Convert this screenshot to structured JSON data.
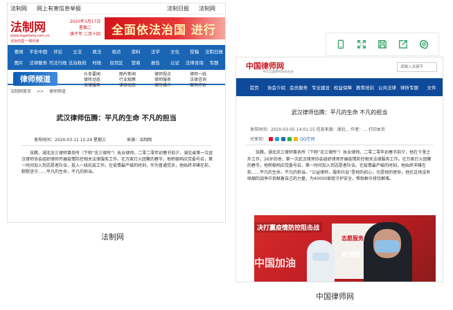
{
  "left": {
    "topbar": [
      "法制网",
      "网上有害信息举报",
      "法制日报",
      "法制网"
    ],
    "logo": "法制网",
    "logo_url": "www.legaldaily.com.cn",
    "logo_tag": "法治中国 一网尽收",
    "date_line1": "2020年3月17日",
    "date_line2": "星期二",
    "date_line3": "庚子年 二月十四",
    "banner": "全面依法治国 进行",
    "nav": [
      "要闻",
      "平安中国",
      "评论",
      "立法",
      "政法",
      "视点",
      "资料",
      "法学",
      "文化",
      "投稿",
      "法制日报",
      "图片",
      "法律服务",
      "司法行政",
      "法治政府",
      "时政",
      "自贸区",
      "营商",
      "报告",
      "公证",
      "法律咨询",
      "专题"
    ],
    "channel": "律师频道",
    "subnav": [
      "头条要闻",
      "图片新闻",
      "律师视点",
      "律师一线",
      "律所动态",
      "行业观察",
      "律师服务",
      "法律咨询",
      "法律服务",
      "律协动态",
      "律所推介",
      "案例评析"
    ],
    "crumb": [
      "法制网首页",
      ">>",
      "律师频道"
    ],
    "title": "武汉律师伍腾：平凡的生命 不凡的担当",
    "meta_time": "发布时间：2020-03-11 15:24 星期三",
    "meta_source": "来源：法制网",
    "body": "伍腾，湖北忠三律师事务所（下称“忠三律所”）执业律师。二零二零年初春节前夕，湖北省第一次武汉律师协会组织律师开展疫情防控相关法律服务工作。在万家灯火团聚的春节，他积极响应党委号召，第一时间加入到志愿者队伍，投入一线抗疫工作。在疫情最严峻的时刻，作为普通党员，他始终冲锋在前，默默坚守……平凡的生命，不凡的担当。",
    "caption": "法制网"
  },
  "toolbar": {
    "icons": [
      "phone-icon",
      "expand-icon",
      "save-icon",
      "share-icon",
      "settings-icon"
    ]
  },
  "right": {
    "logo": "中国律师网",
    "logo_sub": "中华全国律师协会主办",
    "search_placeholder": "请输入关键字",
    "nav": [
      "首页",
      "协会介绍",
      "会员服务",
      "专业建设",
      "权益保障",
      "教育培训",
      "公共法律",
      "律所专题",
      "文件"
    ],
    "title": "武汉律师伍腾：平凡的生命 不凡的担当",
    "meta": "发布时间：2020-03-05 14:01:15  信息来源：湖北...  作者：...  打印本页",
    "share_label": "分享到：",
    "share_items": [
      "QQ空间"
    ],
    "body": "伍腾，湖北忠三律师事务所（下称“忠三律所”）执业律师。二零二零年初春节前夕，他在千里之外工作，26岁的他，第一次武汉律师协会组织律师开展疫情防控相关法律服务工作。在万家灯火团聚的春节，他积极响应党委号召，第一时间加入到志愿者队伍。在疫情最严峻的时刻，他始终冲锋在前……平凡的生命，不凡的担当。“公益律师，服务社会”是他的初心，也是他的使命，他在这场没有硝烟的战争中贡献着自己的力量，为40000家庭守护安全，帮助群众排忧解难。",
    "photo_line1": "决打赢疫情防控阻击战",
    "photo_line2": "中国加油",
    "photo_line3": "新冠肺",
    "photo_panel": "志愿服务",
    "caption": "中国律师网"
  }
}
